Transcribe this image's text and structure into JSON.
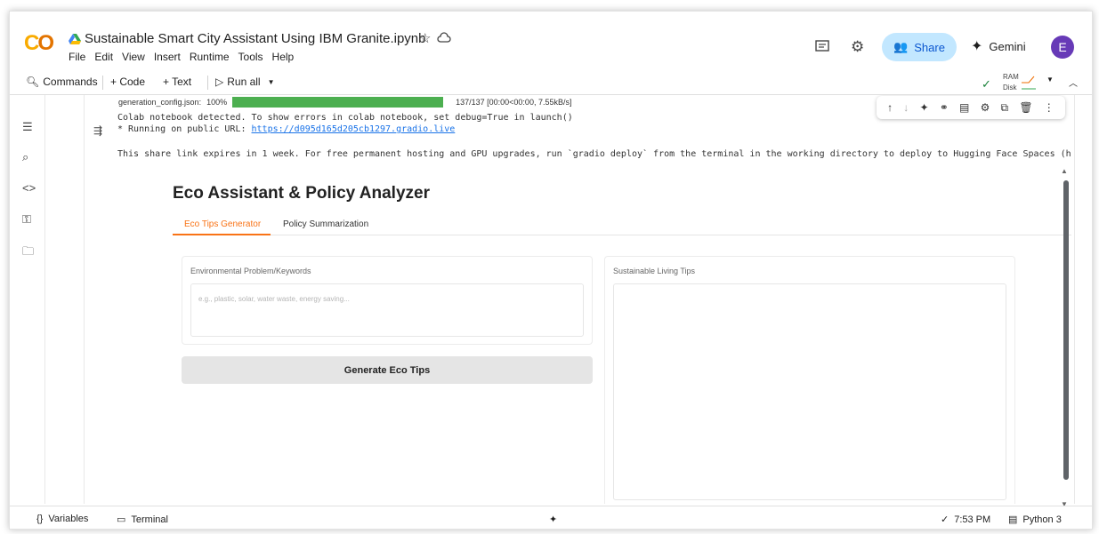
{
  "header": {
    "title": "Sustainable Smart City Assistant Using IBM Granite.ipynb",
    "menu": [
      "File",
      "Edit",
      "View",
      "Insert",
      "Runtime",
      "Tools",
      "Help"
    ],
    "share_label": "Share",
    "gemini_label": "Gemini",
    "avatar_letter": "E"
  },
  "toolbar": {
    "commands_label": "Commands",
    "code_label": "+ Code",
    "text_label": "+ Text",
    "run_all_label": "Run all",
    "ram_label": "RAM",
    "disk_label": "Disk"
  },
  "output": {
    "progress_label": "generation_config.json:",
    "progress_percent": "100%",
    "progress_fraction": 1.0,
    "progress_stats": "137/137 [00:00<00:00, 7.55kB/s]",
    "line1": "Colab notebook detected. To show errors in colab notebook, set debug=True in launch()",
    "line2_prefix": "* Running on public URL: ",
    "public_url": "https://d095d165d205cb1297.gradio.live",
    "line3": "This share link expires in 1 week. For free permanent hosting and GPU upgrades, run `gradio deploy` from the terminal in the working directory to deploy to Hugging Face Spaces (h"
  },
  "app": {
    "title": "Eco Assistant & Policy Analyzer",
    "tabs": [
      "Eco Tips Generator",
      "Policy Summarization"
    ],
    "input_label": "Environmental Problem/Keywords",
    "input_placeholder": "e.g., plastic, solar, water waste, energy saving...",
    "button_label": "Generate Eco Tips",
    "output_label": "Sustainable Living Tips"
  },
  "statusbar": {
    "variables_label": "Variables",
    "terminal_label": "Terminal",
    "time": "7:53 PM",
    "runtime": "Python 3"
  },
  "colors": {
    "accent": "#f97316",
    "progress": "#4caf50",
    "share_bg": "#c2e7ff",
    "avatar_bg": "#673ab7"
  }
}
